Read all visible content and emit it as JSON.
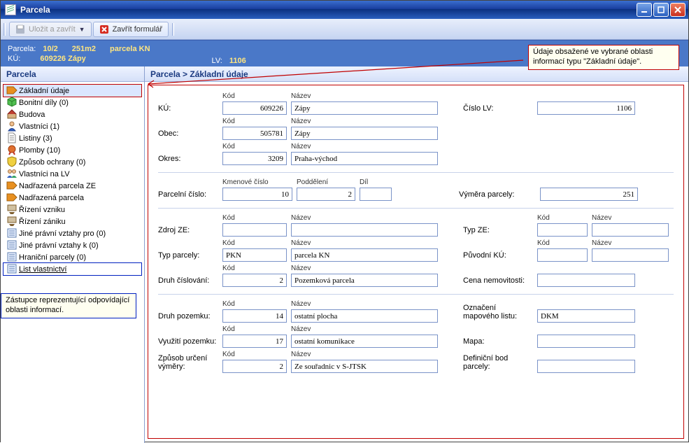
{
  "window": {
    "title": "Parcela"
  },
  "toolbar": {
    "save_close": "Uložit a zavřít",
    "close_form": "Zavřít formulář"
  },
  "info": {
    "parcela_lbl": "Parcela:",
    "parcela_id": "10/2",
    "area": "251m2",
    "type": "parcela KN",
    "ku_lbl": "KÚ:",
    "ku_val": "609226 Zápy",
    "lv_lbl": "LV:",
    "lv_val": "1106"
  },
  "annotations": {
    "top": "Údaje obsažené ve vybrané oblasti informací typu \"Základní údaje\".",
    "side": "Zástupce reprezentující odpovídající oblasti informací."
  },
  "sidebar": {
    "head": "Parcela",
    "items": [
      {
        "label": "Základní údaje"
      },
      {
        "label": "Bonitní díly  (0)"
      },
      {
        "label": "Budova"
      },
      {
        "label": "Vlastníci  (1)"
      },
      {
        "label": "Listiny  (3)"
      },
      {
        "label": "Plomby  (10)"
      },
      {
        "label": "Způsob ochrany  (0)"
      },
      {
        "label": "Vlastníci na LV"
      },
      {
        "label": "Nadřazená parcela ZE"
      },
      {
        "label": "Nadřazená parcela"
      },
      {
        "label": "Řízení vzniku"
      },
      {
        "label": "Řízení zániku"
      },
      {
        "label": "Jiné právní vztahy pro  (0)"
      },
      {
        "label": "Jiné právní vztahy k  (0)"
      },
      {
        "label": "Hraniční parcely  (0)"
      },
      {
        "label": "List vlastnictví"
      }
    ]
  },
  "breadcrumb": "Parcela > Základní údaje",
  "labels": {
    "ku": "KÚ:",
    "obec": "Obec:",
    "okres": "Okres:",
    "kod": "Kód",
    "nazev": "Název",
    "cislo_lv": "Číslo LV:",
    "parcelni_cislo": "Parcelní číslo:",
    "kmenove": "Kmenové číslo",
    "poddel": "Poddělení",
    "dil": "Díl",
    "vymera": "Výměra parcely:",
    "zdroj_ze": "Zdroj ZE:",
    "typ_ze": "Typ ZE:",
    "typ_parcely": "Typ parcely:",
    "puvodni_ku": "Původní KÚ:",
    "druh_cisl": "Druh číslování:",
    "cena": "Cena nemovitosti:",
    "druh_pozemku": "Druh pozemku:",
    "ozn_map": "Označení mapového listu:",
    "vyuziti": "Využití pozemku:",
    "mapa": "Mapa:",
    "zpusob_vym": "Způsob určení výměry:",
    "def_bod": "Definiční bod parcely:"
  },
  "form": {
    "ku_kod": "609226",
    "ku_nazev": "Zápy",
    "obec_kod": "505781",
    "obec_nazev": "Zápy",
    "okres_kod": "3209",
    "okres_nazev": "Praha-východ",
    "lv": "1106",
    "kmenove": "10",
    "poddel": "2",
    "dil": "",
    "vymera": "251",
    "zdroj_ze_kod": "",
    "zdroj_ze_naz": "",
    "typ_ze_kod": "",
    "typ_ze_naz": "",
    "typ_parc_kod": "PKN",
    "typ_parc_naz": "parcela KN",
    "puvodni_ku_kod": "",
    "puvodni_ku_naz": "",
    "druh_cisl_kod": "2",
    "druh_cisl_naz": "Pozemková parcela",
    "cena": "",
    "druh_poz_kod": "14",
    "druh_poz_naz": "ostatní plocha",
    "ozn_map": "DKM",
    "vyuziti_kod": "17",
    "vyuziti_naz": "ostatní komunikace",
    "mapa": "",
    "zpusob_kod": "2",
    "zpusob_naz": "Ze souřadnic v S-JTSK",
    "def_bod": ""
  }
}
